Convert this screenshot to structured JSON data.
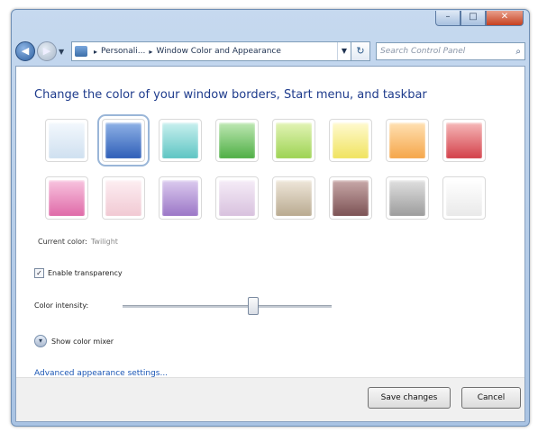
{
  "window": {
    "controls": {
      "minimize": "–",
      "maximize": "□",
      "close": "✕"
    }
  },
  "navigation": {
    "back_icon": "back-arrow-icon",
    "forward_icon": "forward-arrow-icon",
    "breadcrumb": [
      "Personali...",
      "Window Color and Appearance"
    ],
    "search_placeholder": "Search Control Panel"
  },
  "page": {
    "heading": "Change the color of your window borders, Start menu, and taskbar",
    "current_color_label": "Current color:",
    "current_color_value": "Twilight",
    "transparency_label": "Enable transparency",
    "transparency_checked": true,
    "intensity_label": "Color intensity:",
    "intensity_value": 0.62,
    "color_mixer_label": "Show color mixer",
    "advanced_link": "Advanced appearance settings..."
  },
  "swatches": {
    "row1": [
      {
        "name": "sky",
        "top": "#f3f8fd",
        "bottom": "#cfe0f0"
      },
      {
        "name": "twilight",
        "top": "#8fb2e6",
        "bottom": "#2f5fb8",
        "selected": true
      },
      {
        "name": "sea",
        "top": "#c9f0ef",
        "bottom": "#5ec5c3"
      },
      {
        "name": "leaf",
        "top": "#bfe8b4",
        "bottom": "#4faf45"
      },
      {
        "name": "lime",
        "top": "#e3f4b6",
        "bottom": "#9dd353"
      },
      {
        "name": "lemon",
        "top": "#fffad0",
        "bottom": "#f0e35f"
      },
      {
        "name": "tangerine",
        "top": "#ffe1b3",
        "bottom": "#f5a64a"
      },
      {
        "name": "ruby",
        "top": "#f6b9b9",
        "bottom": "#d3404a"
      }
    ],
    "row2": [
      {
        "name": "fuchsia",
        "top": "#f8c4df",
        "bottom": "#df6aa8"
      },
      {
        "name": "blush",
        "top": "#fdeef2",
        "bottom": "#f1c9d3"
      },
      {
        "name": "violet",
        "top": "#dccbef",
        "bottom": "#9b76c7"
      },
      {
        "name": "lavender",
        "top": "#f5ecf7",
        "bottom": "#d8c1de"
      },
      {
        "name": "taupe",
        "top": "#efe7da",
        "bottom": "#b9aa90"
      },
      {
        "name": "chocolate",
        "top": "#c9a9a9",
        "bottom": "#7c5254"
      },
      {
        "name": "slate",
        "top": "#e0e0e0",
        "bottom": "#9c9c9c"
      },
      {
        "name": "frost",
        "top": "#ffffff",
        "bottom": "#e9e9e9"
      }
    ]
  },
  "footer": {
    "save_label": "Save changes",
    "cancel_label": "Cancel"
  }
}
